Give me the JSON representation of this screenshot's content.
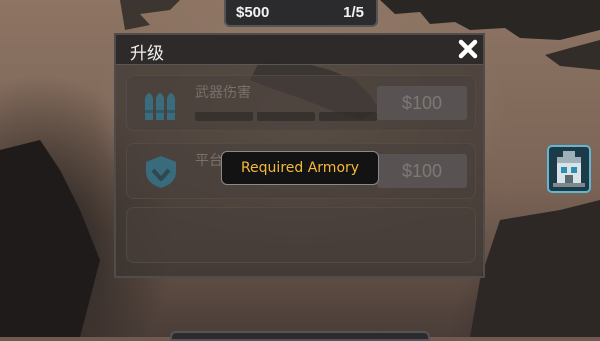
{
  "hud": {
    "money": "$500",
    "wave": "1/5"
  },
  "upgrade_panel": {
    "title": "升级",
    "close_icon": "close-x-icon",
    "rows": [
      {
        "label": "武器伤害",
        "price": "$100",
        "icon": "ammo-bullets-icon",
        "levels": 3
      },
      {
        "label": "平台护",
        "price": "$100",
        "icon": "shield-icon",
        "levels": 3
      },
      {
        "label": "",
        "price": "",
        "icon": "",
        "levels": 0
      }
    ],
    "tooltip": "Required Armory"
  },
  "side_menu": {
    "icon": "armory-building-icon"
  },
  "colors": {
    "accent_tooltip_text": "#f5b83c",
    "side_icon_border": "#5fb7d1",
    "icon_blue": "#2a8fb0"
  }
}
